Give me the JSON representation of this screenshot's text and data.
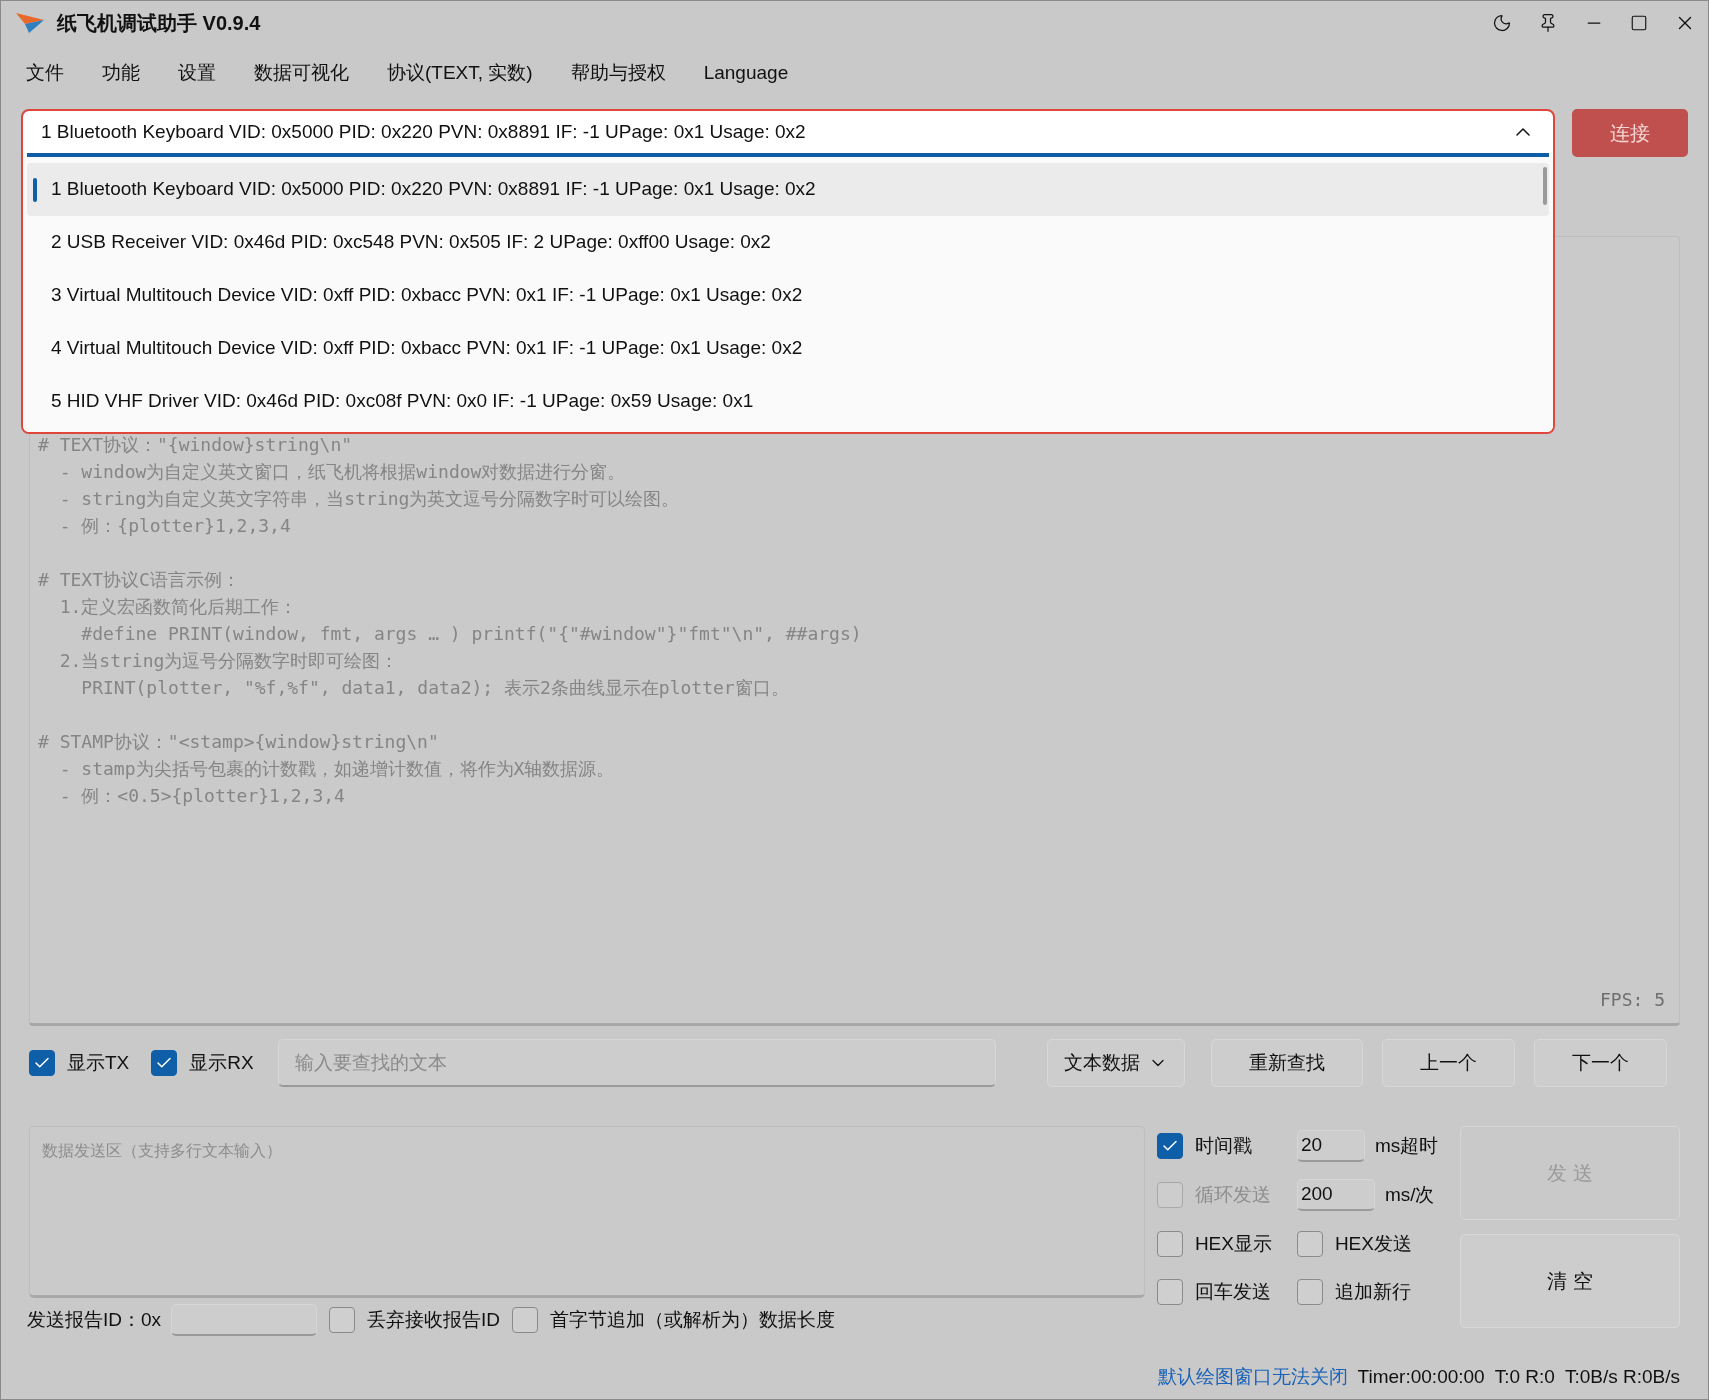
{
  "window": {
    "title": "纸飞机调试助手 V0.9.4"
  },
  "menu": [
    "文件",
    "功能",
    "设置",
    "数据可视化",
    "协议(TEXT, 实数)",
    "帮助与授权",
    "Language"
  ],
  "device_select": {
    "value": "1 Bluetooth Keyboard VID: 0x5000 PID: 0x220 PVN: 0x8891 IF: -1 UPage: 0x1 Usage: 0x2",
    "expanded": true,
    "options": [
      {
        "label": "1 Bluetooth Keyboard VID: 0x5000 PID: 0x220 PVN: 0x8891 IF: -1 UPage: 0x1 Usage: 0x2",
        "selected": true
      },
      {
        "label": "2 USB Receiver VID: 0x46d PID: 0xc548 PVN: 0x505 IF: 2 UPage: 0xff00 Usage: 0x2",
        "selected": false
      },
      {
        "label": "3 Virtual Multitouch Device VID: 0xff PID: 0xbacc PVN: 0x1 IF: -1 UPage: 0x1 Usage: 0x2",
        "selected": false
      },
      {
        "label": "4 Virtual Multitouch Device VID: 0xff PID: 0xbacc PVN: 0x1 IF: -1 UPage: 0x1 Usage: 0x2",
        "selected": false
      },
      {
        "label": "5 HID VHF Driver VID: 0x46d PID: 0xc08f PVN: 0x0 IF: -1 UPage: 0x59 Usage: 0x1",
        "selected": false
      }
    ]
  },
  "connect_button": "连接",
  "log": {
    "blocks": [
      [
        "# TEXT协议：\"{window}string\\n\"",
        "  - window为自定义英文窗口，纸飞机将根据window对数据进行分窗。",
        "  - string为自定义英文字符串，当string为英文逗号分隔数字时可以绘图。",
        "  - 例：{plotter}1,2,3,4"
      ],
      [
        "# TEXT协议C语言示例：",
        "  1.定义宏函数简化后期工作：",
        "    #define PRINT(window, fmt, args … ) printf(\"{\"#window\"}\"fmt\"\\n\", ##args)",
        "  2.当string为逗号分隔数字时即可绘图：",
        "    PRINT(plotter, \"%f,%f\", data1, data2); 表示2条曲线显示在plotter窗口。"
      ],
      [
        "# STAMP协议：\"<stamp>{window}string\\n\"",
        "  - stamp为尖括号包裹的计数戳，如递增计数值，将作为X轴数据源。",
        "  - 例：<0.5>{plotter}1,2,3,4"
      ]
    ],
    "fps": "FPS: 5"
  },
  "find_bar": {
    "checkboxes": [
      {
        "label": "显示TX",
        "checked": true
      },
      {
        "label": "显示RX",
        "checked": true
      }
    ],
    "search": {
      "placeholder": "输入要查找的文本"
    },
    "mode": "文本数据",
    "buttons": [
      "重新查找",
      "上一个",
      "下一个"
    ]
  },
  "send": {
    "placeholder": "数据发送区（支持多行文本输入）",
    "timestamp": {
      "label": "时间戳",
      "checked": true,
      "disabled": false,
      "value": "20",
      "unit": "ms超时"
    },
    "loop": {
      "label": "循环发送",
      "checked": false,
      "disabled": true,
      "value": "200",
      "unit": "ms/次"
    },
    "options": [
      {
        "label": "HEX显示",
        "checked": false
      },
      {
        "label": "HEX发送",
        "checked": false
      },
      {
        "label": "回车发送",
        "checked": false
      },
      {
        "label": "追加新行",
        "checked": false
      }
    ],
    "send_button": {
      "label": "发 送",
      "disabled": true
    },
    "clear_button": "清 空"
  },
  "report": {
    "label": "发送报告ID：0x",
    "options": [
      {
        "label": "丢弃接收报告ID",
        "checked": false
      },
      {
        "label": "首字节追加（或解析为）数据长度",
        "checked": false
      }
    ]
  },
  "status_bar": {
    "link": "默认绘图窗口无法关闭",
    "items": [
      "Timer:00:00:00",
      "T:0 R:0",
      "T:0B/s R:0B/s"
    ]
  }
}
